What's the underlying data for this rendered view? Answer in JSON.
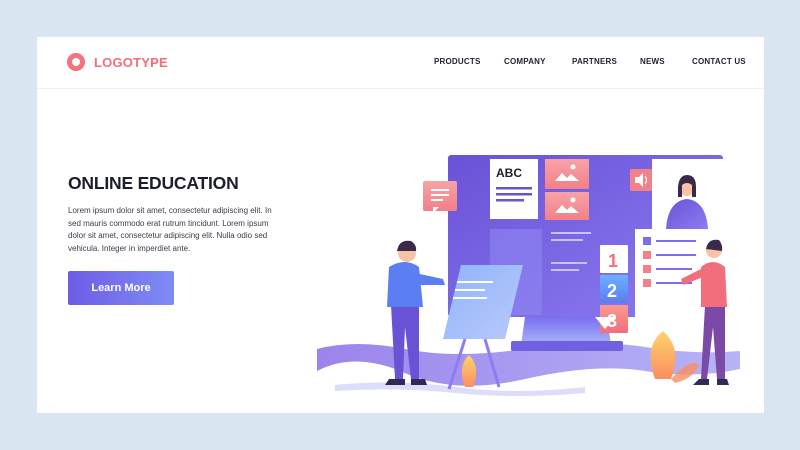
{
  "header": {
    "logo_text": "LOGOTYPE",
    "nav": [
      "PRODUCTS",
      "COMPANY",
      "PARTNERS",
      "NEWS",
      "CONTACT US"
    ]
  },
  "hero": {
    "title": "ONLINE EDUCATION",
    "body": "Lorem ipsum dolor sit amet, consectetur adipiscing elit. In sed mauris commodo erat rutrum tincidunt. Lorem ipsum dolor sit amet, consectetur adipiscing elit. Nulla odio sed vehicula. Integer in imperdiet ante.",
    "button_label": "Learn More"
  },
  "illustration": {
    "abc_label": "ABC",
    "steps": [
      "1",
      "2",
      "3"
    ],
    "icons": [
      "chat-bubble-icon",
      "image-icon",
      "speaker-icon",
      "play-triangle-icon"
    ]
  },
  "colors": {
    "background": "#d9e6f2",
    "accent_coral": "#ef6f7a",
    "accent_purple": "#6f5ce6",
    "accent_blue": "#7f8cf4"
  }
}
